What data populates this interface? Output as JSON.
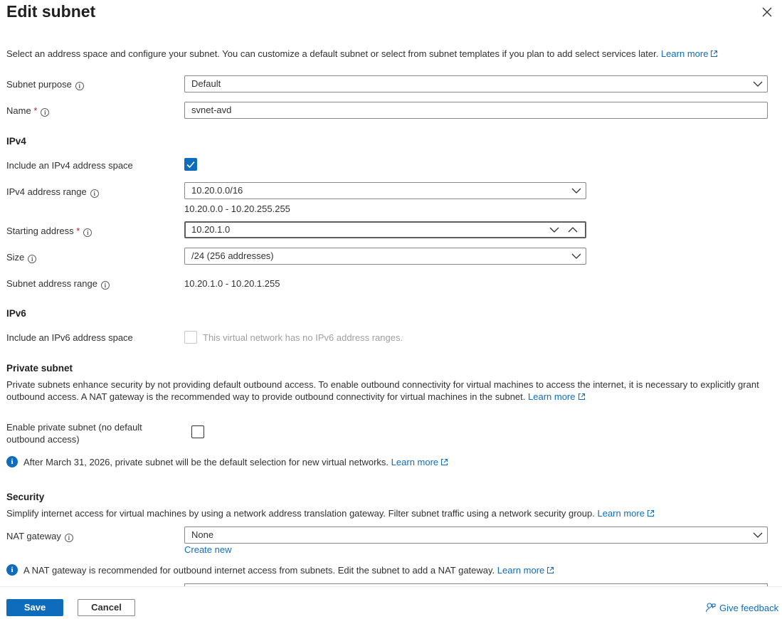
{
  "header": {
    "title": "Edit subnet"
  },
  "intro": {
    "text": "Select an address space and configure your subnet. You can customize a default subnet or select from subnet templates if you plan to add select services later.",
    "learn_more": "Learn more"
  },
  "subnet_purpose": {
    "label": "Subnet purpose",
    "value": "Default"
  },
  "name": {
    "label": "Name",
    "required": "*",
    "value": "svnet-avd"
  },
  "ipv4": {
    "heading": "IPv4",
    "include_label": "Include an IPv4 address space",
    "include_checked": true,
    "range_label": "IPv4 address range",
    "range_value": "10.20.0.0/16",
    "range_hint": "10.20.0.0 - 10.20.255.255",
    "start_label": "Starting address",
    "start_required": "*",
    "start_value": "10.20.1.0",
    "size_label": "Size",
    "size_value": "/24 (256 addresses)",
    "subnet_range_label": "Subnet address range",
    "subnet_range_value": "10.20.1.0 - 10.20.1.255"
  },
  "ipv6": {
    "heading": "IPv6",
    "include_label": "Include an IPv6 address space",
    "include_checked": false,
    "disabled_text": "This virtual network has no IPv6 address ranges."
  },
  "private_subnet": {
    "heading": "Private subnet",
    "desc_line1": "Private subnets enhance security by not providing default outbound access. To enable outbound connectivity for virtual machines to access the internet, it is necessary to explicitly grant",
    "desc_line2": "outbound access. A NAT gateway is the recommended way to provide outbound connectivity for virtual machines in the subnet.",
    "learn_more": "Learn more",
    "enable_label_line1": "Enable private subnet (no default",
    "enable_label_line2": "outbound access)",
    "enable_checked": false,
    "info_text": "After March 31, 2026, private subnet will be the default selection for new virtual networks.",
    "info_learn_more": "Learn more"
  },
  "security": {
    "heading": "Security",
    "desc": "Simplify internet access for virtual machines by using a network address translation gateway. Filter subnet traffic using a network security group.",
    "learn_more": "Learn more",
    "nat_label": "NAT gateway",
    "nat_value": "None",
    "create_new": "Create new",
    "nat_info": "A NAT gateway is recommended for outbound internet access from subnets. Edit the subnet to add a NAT gateway.",
    "nat_info_learn_more": "Learn more"
  },
  "footer": {
    "save": "Save",
    "cancel": "Cancel",
    "feedback": "Give feedback"
  },
  "colors": {
    "accent": "#0f6cbd",
    "required": "#a4262c",
    "text": "#323130"
  }
}
